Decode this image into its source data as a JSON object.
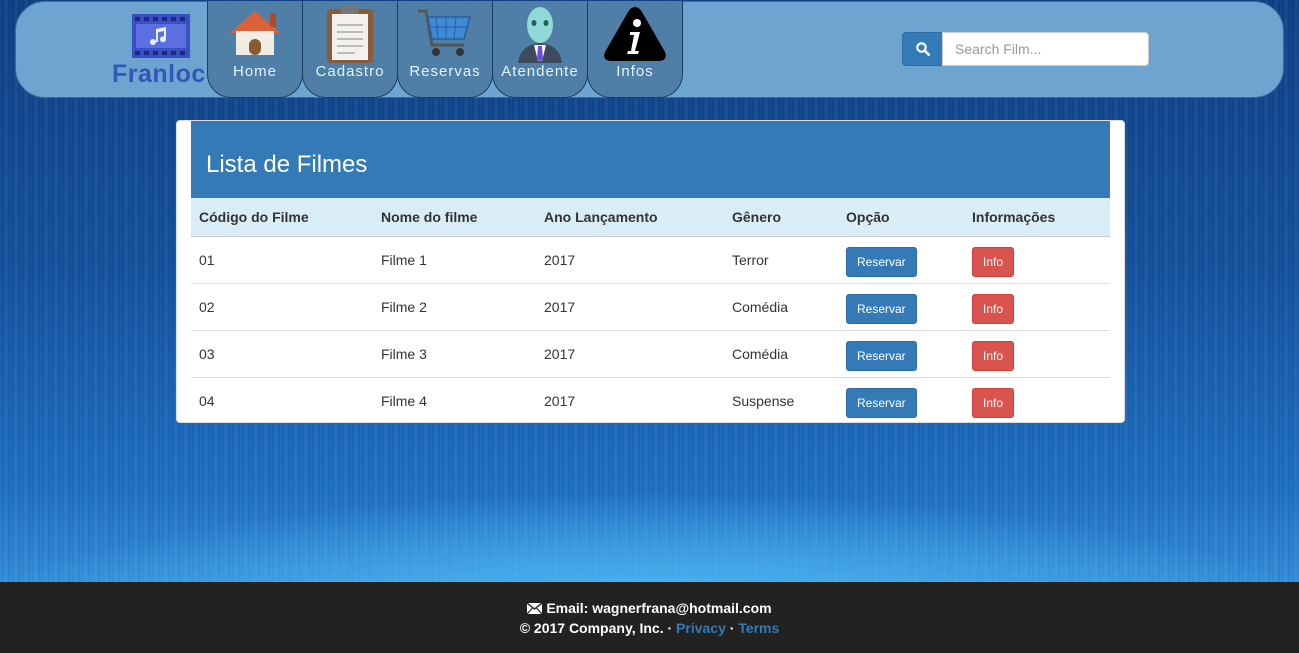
{
  "brand": {
    "name": "Franloc"
  },
  "nav": {
    "tabs": [
      {
        "label": "Home",
        "icon": "house-icon"
      },
      {
        "label": "Cadastro",
        "icon": "clipboard-icon"
      },
      {
        "label": "Reservas",
        "icon": "shopping-cart-icon"
      },
      {
        "label": "Atendente",
        "icon": "attendant-icon"
      },
      {
        "label": "Infos",
        "icon": "info-icon"
      }
    ]
  },
  "search": {
    "placeholder": "Search Film...",
    "value": "",
    "icon": "search-icon"
  },
  "panel": {
    "title": "Lista de Filmes",
    "columns": [
      "Código do Filme",
      "Nome do filme",
      "Ano Lançamento",
      "Gênero",
      "Opção",
      "Informações"
    ],
    "rows": [
      {
        "code": "01",
        "name": "Filme 1",
        "year": "2017",
        "genre": "Terror",
        "reserve": "Reservar",
        "info": "Info"
      },
      {
        "code": "02",
        "name": "Filme 2",
        "year": "2017",
        "genre": "Comédia",
        "reserve": "Reservar",
        "info": "Info"
      },
      {
        "code": "03",
        "name": "Filme 3",
        "year": "2017",
        "genre": "Comédia",
        "reserve": "Reservar",
        "info": "Info"
      },
      {
        "code": "04",
        "name": "Filme 4",
        "year": "2017",
        "genre": "Suspense",
        "reserve": "Reservar",
        "info": "Info"
      }
    ]
  },
  "footer": {
    "email_label": "Email: wagnerfrana@hotmail.com",
    "copyright": "© 2017 Company, Inc. ·",
    "privacy": "Privacy",
    "separator": "·",
    "terms": "Terms"
  },
  "colors": {
    "primary": "#337ab7",
    "danger": "#d9534f",
    "navbar": "#6ea4d0",
    "footer": "#222222",
    "table_header": "#d9edf7"
  }
}
